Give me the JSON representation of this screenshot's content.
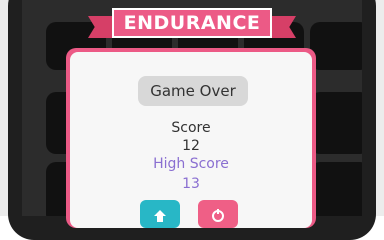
{
  "banner": {
    "title": "ENDURANCE"
  },
  "dialog": {
    "status_label": "Game Over",
    "score_label": "Score",
    "score_value": "12",
    "high_score_label": "High Score",
    "high_score_value": "13"
  },
  "buttons": [
    {
      "name": "share-button",
      "icon": "upload-icon",
      "color": "#28b7c6"
    },
    {
      "name": "restart-button",
      "icon": "restart-icon",
      "color": "#ef5f86"
    }
  ],
  "colors": {
    "accent": "#ec5a86",
    "high_score": "#8a6fd1",
    "text": "#333333",
    "board_tile": "#111111"
  }
}
